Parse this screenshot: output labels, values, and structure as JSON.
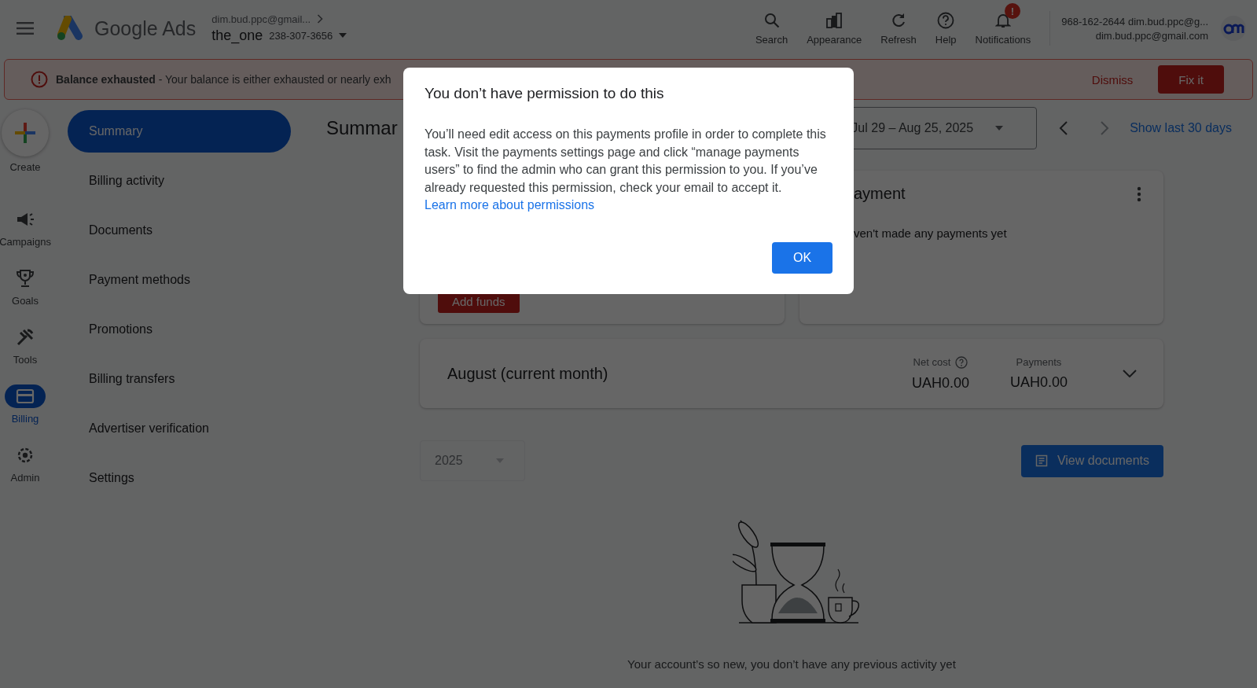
{
  "top_bar": {
    "logo_text": "Google Ads",
    "account": {
      "email": "dim.bud.ppc@gmail...",
      "name": "the_one",
      "id": "238-307-3656"
    },
    "tools": [
      {
        "kind": "search",
        "label": "Search"
      },
      {
        "kind": "appearance",
        "label": "Appearance"
      },
      {
        "kind": "refresh",
        "label": "Refresh"
      },
      {
        "kind": "help",
        "label": "Help"
      },
      {
        "kind": "notifications",
        "label": "Notifications",
        "badge": "!"
      }
    ],
    "user": {
      "line1": "968-162-2644 dim.bud.ppc@g...",
      "line2": "dim.bud.ppc@gmail.com"
    }
  },
  "alert": {
    "message": "**Balance exhausted** - Your balance is either exhausted or nearly exh",
    "dismiss": "Dismiss",
    "fix": "Fix it"
  },
  "rail": [
    {
      "kind": "create",
      "label": "Create",
      "selected": false
    },
    {
      "kind": "campaigns",
      "label": "Campaigns",
      "selected": false
    },
    {
      "kind": "goals",
      "label": "Goals",
      "selected": false
    },
    {
      "kind": "tools",
      "label": "Tools",
      "selected": false
    },
    {
      "kind": "billing",
      "label": "Billing",
      "selected": true
    },
    {
      "kind": "admin",
      "label": "Admin",
      "selected": false
    }
  ],
  "nav": [
    {
      "label": "Summary",
      "selected": true
    },
    {
      "label": "Billing activity",
      "selected": false
    },
    {
      "label": "Documents",
      "selected": false
    },
    {
      "label": "Payment methods",
      "selected": false
    },
    {
      "label": "Promotions",
      "selected": false
    },
    {
      "label": "Billing transfers",
      "selected": false
    },
    {
      "label": "Advertiser verification",
      "selected": false
    },
    {
      "label": "Settings",
      "selected": false
    }
  ],
  "page": {
    "title": "Summar",
    "date_range": "Jul 29 – Aug 25, 2025",
    "show_last": "Show last 30 days"
  },
  "funds_card": {
    "button": "Add funds"
  },
  "payment_card": {
    "title": "ayment",
    "message": "ven't made any payments yet"
  },
  "month_card": {
    "title": "August (current month)",
    "metrics": [
      {
        "label": "Net cost",
        "help": true,
        "value": "UAH0.00"
      },
      {
        "label": "Payments",
        "help": false,
        "value": "UAH0.00"
      }
    ]
  },
  "year_select": {
    "value": "2025",
    "disabled": true
  },
  "view_documents": "View documents",
  "empty_message": "Your account’s so new, you don’t have any previous activity yet",
  "dialog": {
    "title": "You don’t have permission to do this",
    "body": "You’ll need edit access on this payments profile in order to complete this task. Visit the payments settings page and click “manage payments users” to find the admin who can grant this permission to you. If you’ve already requested this permission, check your email to accept it.",
    "link": "Learn more about permissions",
    "ok": "OK"
  }
}
